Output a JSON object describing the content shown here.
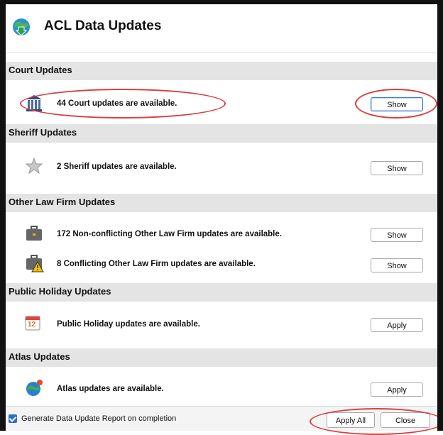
{
  "window": {
    "title": "ACL Data Updates"
  },
  "sections": [
    {
      "title": "Court Updates",
      "rows": [
        {
          "icon": "court-building-icon",
          "text": "44 Court updates are available.",
          "button": "Show"
        }
      ]
    },
    {
      "title": "Sheriff Updates",
      "rows": [
        {
          "icon": "sheriff-star-icon",
          "text": "2 Sheriff updates are available.",
          "button": "Show"
        }
      ]
    },
    {
      "title": "Other Law Firm Updates",
      "rows": [
        {
          "icon": "briefcase-icon",
          "text": "172 Non-conflicting Other Law Firm updates are available.",
          "button": "Show"
        },
        {
          "icon": "briefcase-warning-icon",
          "text": "8 Conflicting Other Law Firm updates are available.",
          "button": "Show"
        }
      ]
    },
    {
      "title": "Public Holiday Updates",
      "rows": [
        {
          "icon": "calendar-icon",
          "text": "Public Holiday updates are available.",
          "button": "Apply",
          "calendar_day": "12"
        }
      ]
    },
    {
      "title": "Atlas Updates",
      "rows": [
        {
          "icon": "globe-icon",
          "text": "Atlas updates are available.",
          "button": "Apply"
        }
      ]
    }
  ],
  "footer": {
    "checkbox_label": "Generate Data Update Report on completion",
    "checkbox_checked": true,
    "apply_all": "Apply All",
    "close": "Close"
  },
  "colors": {
    "accent": "#2d6ec7",
    "annotation": "#d94040",
    "section_bg": "#e4e4e4"
  }
}
